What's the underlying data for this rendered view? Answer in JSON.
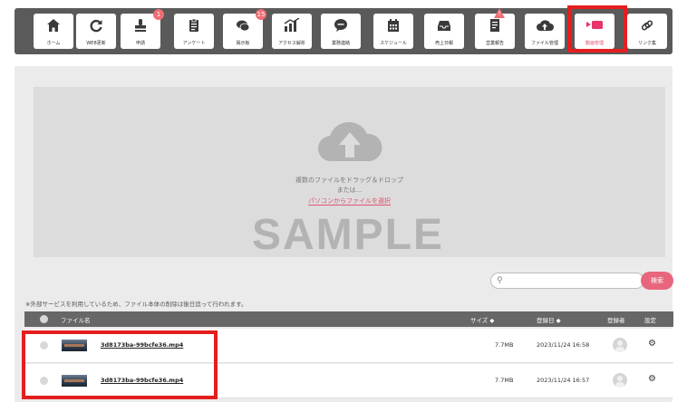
{
  "toolbar": {
    "items": [
      {
        "label": "ホーム",
        "icon": "home-icon"
      },
      {
        "label": "WEB更新",
        "icon": "refresh-icon"
      },
      {
        "label": "申請",
        "icon": "stamp-icon",
        "badge": "1"
      },
      {
        "label": "アンケート",
        "icon": "clipboard-icon"
      },
      {
        "label": "掲示板",
        "icon": "chat-icon",
        "badge": "15"
      },
      {
        "label": "アクセス解析",
        "icon": "chart-icon"
      },
      {
        "label": "業務連絡",
        "icon": "message-icon"
      },
      {
        "label": "スケジュール",
        "icon": "calendar-icon"
      },
      {
        "label": "売上日報",
        "icon": "inbox-icon"
      },
      {
        "label": "営業報告",
        "icon": "document-icon",
        "badge": "!"
      },
      {
        "label": "ファイル管理",
        "icon": "cloud-upload-icon"
      },
      {
        "label": "動画管理",
        "icon": "video-icon",
        "active": true
      },
      {
        "label": "リンク集",
        "icon": "link-icon"
      }
    ]
  },
  "upload": {
    "line1": "複数のファイルをドラッグ＆ドロップ",
    "line2": "または...",
    "select_link": "パソコンからファイルを選択",
    "watermark": "SAMPLE"
  },
  "search": {
    "placeholder": "",
    "button": "検索"
  },
  "notice": "※外部サービスを利用しているため、ファイル本体の削除は後日追って行われます。",
  "table": {
    "headers": {
      "name": "ファイル名",
      "size": "サイズ ◆",
      "date": "登録日 ◆",
      "owner": "登録者",
      "settings": "設定"
    },
    "rows": [
      {
        "name": "3d8173ba-99bcfe36.mp4",
        "size": "7.7MB",
        "date": "2023/11/24 16:58"
      },
      {
        "name": "3d8173ba-99bcfe36.mp4",
        "size": "7.7MB",
        "date": "2023/11/24 16:57"
      }
    ]
  },
  "colors": {
    "accent": "#e8667d",
    "toolbar_bg": "#5a5a5a",
    "highlight": "#e41e1e"
  }
}
